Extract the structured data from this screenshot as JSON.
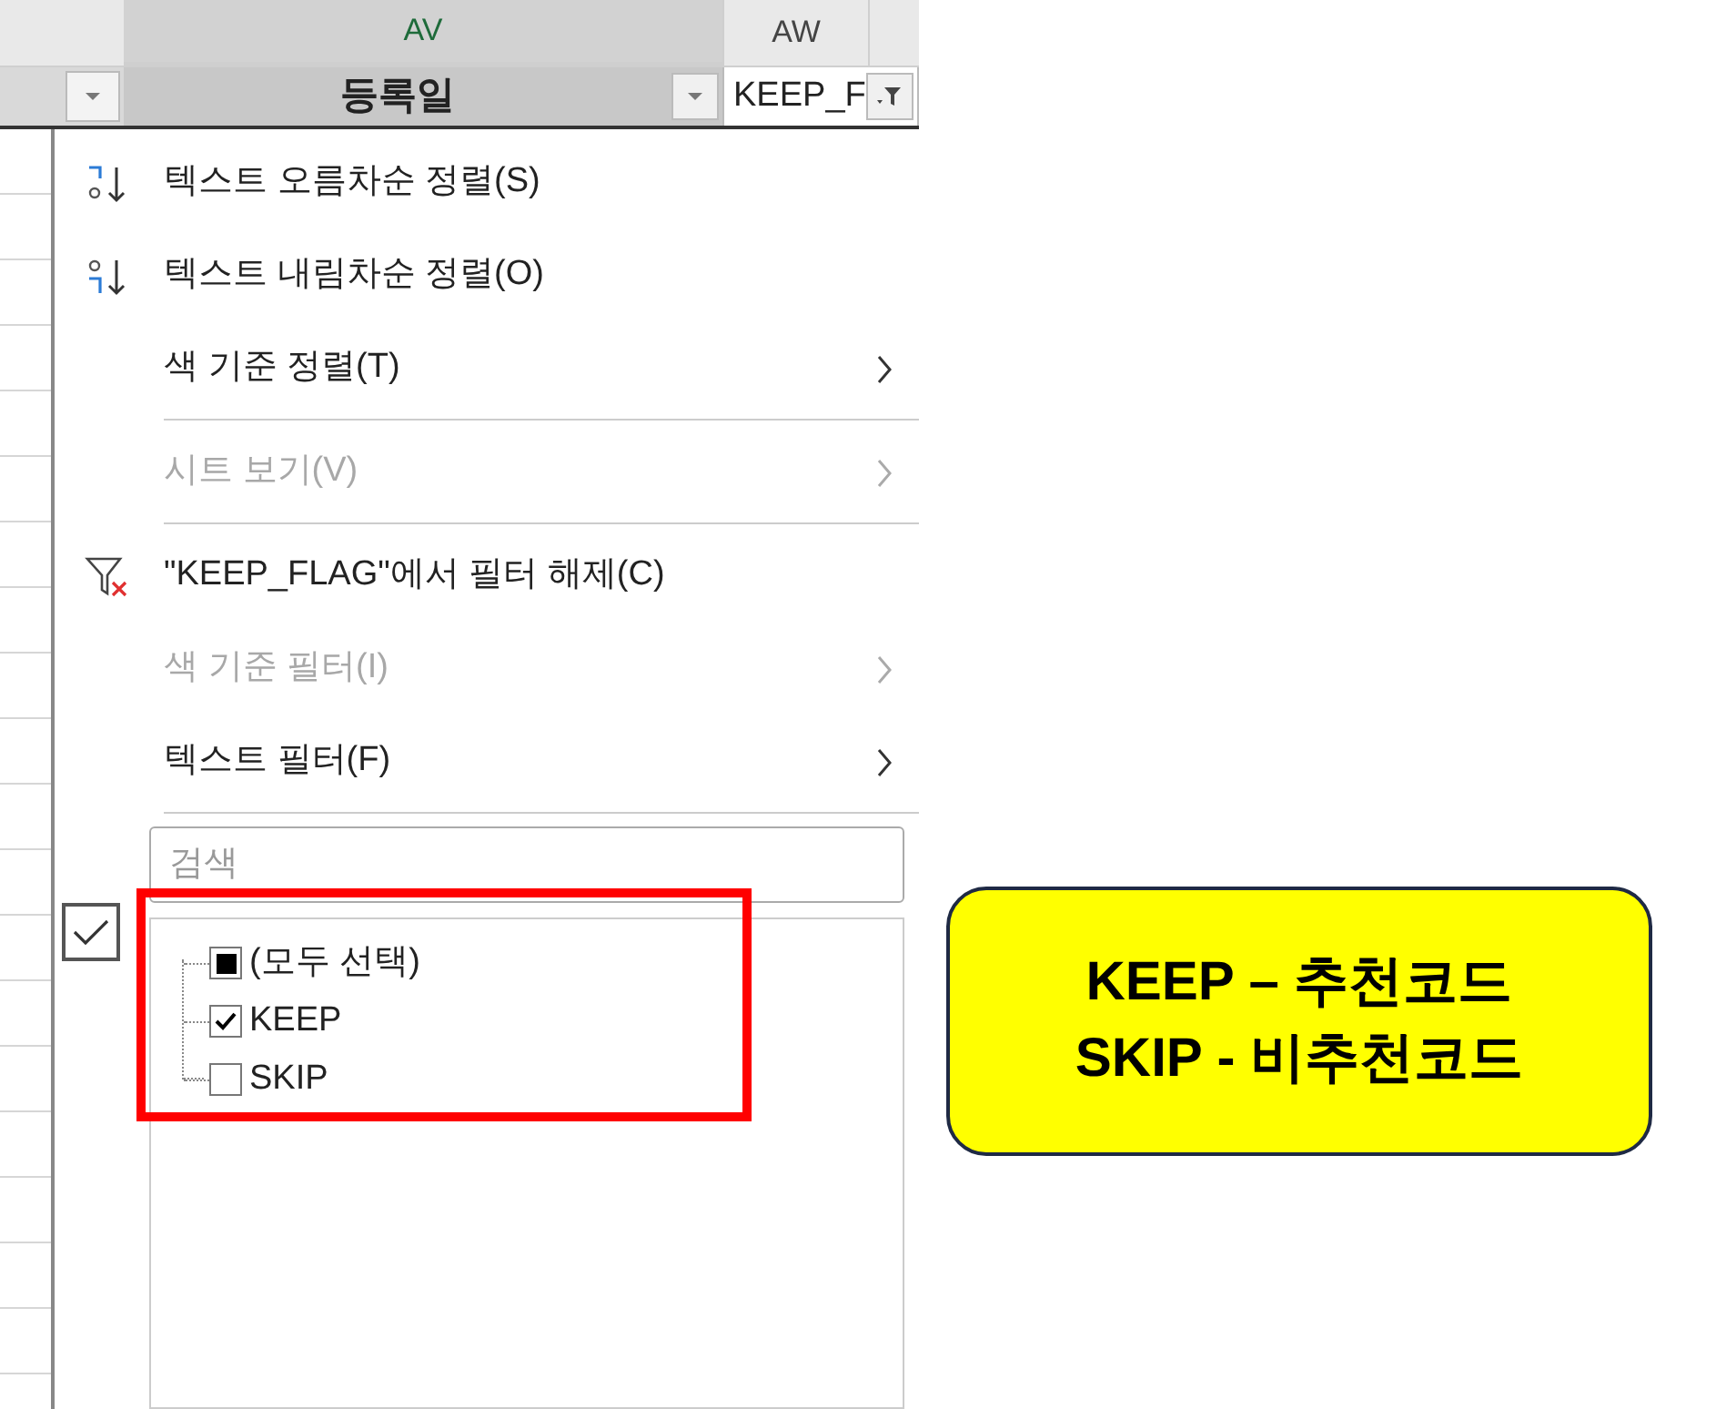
{
  "columns": [
    {
      "letter": "AV",
      "selected": true
    },
    {
      "letter": "AW",
      "selected": false
    }
  ],
  "filter_cells": [
    {
      "label": "등록일",
      "selected": true,
      "filtered": false
    },
    {
      "label": "KEEP_F",
      "selected": false,
      "filtered": true
    }
  ],
  "menu": [
    {
      "kind": "ascending",
      "label": "텍스트 오름차순 정렬(S)",
      "disabled": false,
      "submenu": false
    },
    {
      "kind": "descending",
      "label": "텍스트 내림차순 정렬(O)",
      "disabled": false,
      "submenu": false
    },
    {
      "kind": "item",
      "label": "색 기준 정렬(T)",
      "disabled": false,
      "submenu": true
    },
    {
      "kind": "separator"
    },
    {
      "kind": "item",
      "label": "시트 보기(V)",
      "disabled": true,
      "submenu": true
    },
    {
      "kind": "separator"
    },
    {
      "kind": "unfilter",
      "label": "\"KEEP_FLAG\"에서 필터 해제(C)",
      "disabled": false,
      "submenu": false
    },
    {
      "kind": "item",
      "label": "색 기준 필터(I)",
      "disabled": true,
      "submenu": true
    },
    {
      "kind": "item",
      "label": "텍스트 필터(F)",
      "disabled": false,
      "submenu": true
    },
    {
      "kind": "separator"
    }
  ],
  "search": {
    "placeholder": "검색"
  },
  "side_toggle": {
    "checked": true
  },
  "values": [
    {
      "label": "(모두 선택)",
      "checked": false,
      "partial": true
    },
    {
      "label": "KEEP",
      "checked": true,
      "partial": false
    },
    {
      "label": "SKIP",
      "checked": false,
      "partial": false
    }
  ],
  "callout": {
    "lines": [
      "KEEP – 추천코드",
      "SKIP - 비추천코드"
    ]
  }
}
